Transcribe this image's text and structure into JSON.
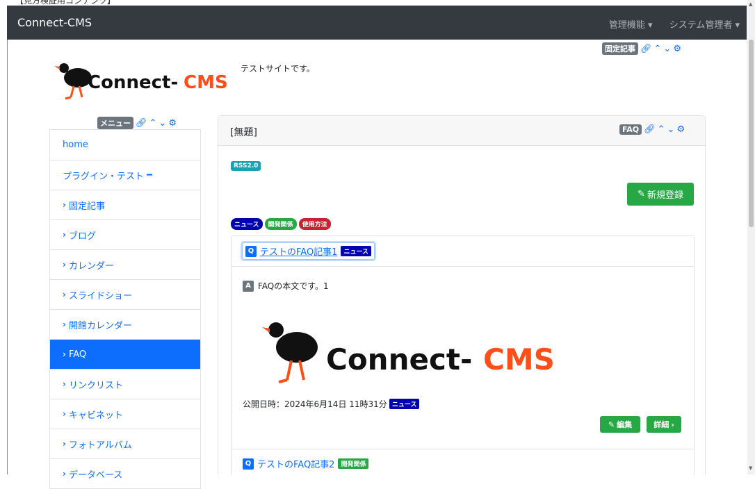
{
  "window_title_partial": "【見方検証用コンテンツ】",
  "navbar": {
    "brand": "Connect-CMS",
    "admin_menu": "管理機能",
    "user_menu": "システム管理者"
  },
  "site": {
    "logo_text_a": "Connect-",
    "logo_text_b": "CMS",
    "description": "テストサイトです。"
  },
  "frames": {
    "fixed_article_badge": "固定記事",
    "menu_badge": "メニュー",
    "faq_badge": "FAQ"
  },
  "menu": {
    "items": [
      {
        "label": "home",
        "chevron": false,
        "active": false
      },
      {
        "label": "プラグイン・テスト",
        "chevron": false,
        "active": false,
        "suffix": "━"
      },
      {
        "label": "固定記事",
        "chevron": true,
        "active": false
      },
      {
        "label": "ブログ",
        "chevron": true,
        "active": false
      },
      {
        "label": "カレンダー",
        "chevron": true,
        "active": false
      },
      {
        "label": "スライドショー",
        "chevron": true,
        "active": false
      },
      {
        "label": "開館カレンダー",
        "chevron": true,
        "active": false
      },
      {
        "label": "FAQ",
        "chevron": true,
        "active": true
      },
      {
        "label": "リンクリスト",
        "chevron": true,
        "active": false
      },
      {
        "label": "キャビネット",
        "chevron": true,
        "active": false
      },
      {
        "label": "フォトアルバム",
        "chevron": true,
        "active": false
      },
      {
        "label": "データベース",
        "chevron": true,
        "active": false
      }
    ]
  },
  "faq": {
    "title": "[無題]",
    "rss": "RSS2.0",
    "new_button": "新規登録",
    "categories": [
      {
        "label": "ニュース",
        "color": "#0000b3"
      },
      {
        "label": "開発関係",
        "color": "#28a745"
      },
      {
        "label": "使用方法",
        "color": "#c82333"
      }
    ],
    "items": [
      {
        "question": "テストのFAQ記事1",
        "category": "ニュース",
        "answer": "FAQの本文です。1",
        "published_label": "公開日時：2024年6月14日 11時31分",
        "edit_button": "編集",
        "detail_button": "詳細"
      },
      {
        "question": "テストのFAQ記事2",
        "category": "開発関係"
      }
    ],
    "q_mark": "Q",
    "a_mark": "A"
  },
  "colors": {
    "navbar": "#343a40",
    "primary": "#0d6efd",
    "success": "#28a745",
    "logo_orange": "#ff4e17"
  }
}
